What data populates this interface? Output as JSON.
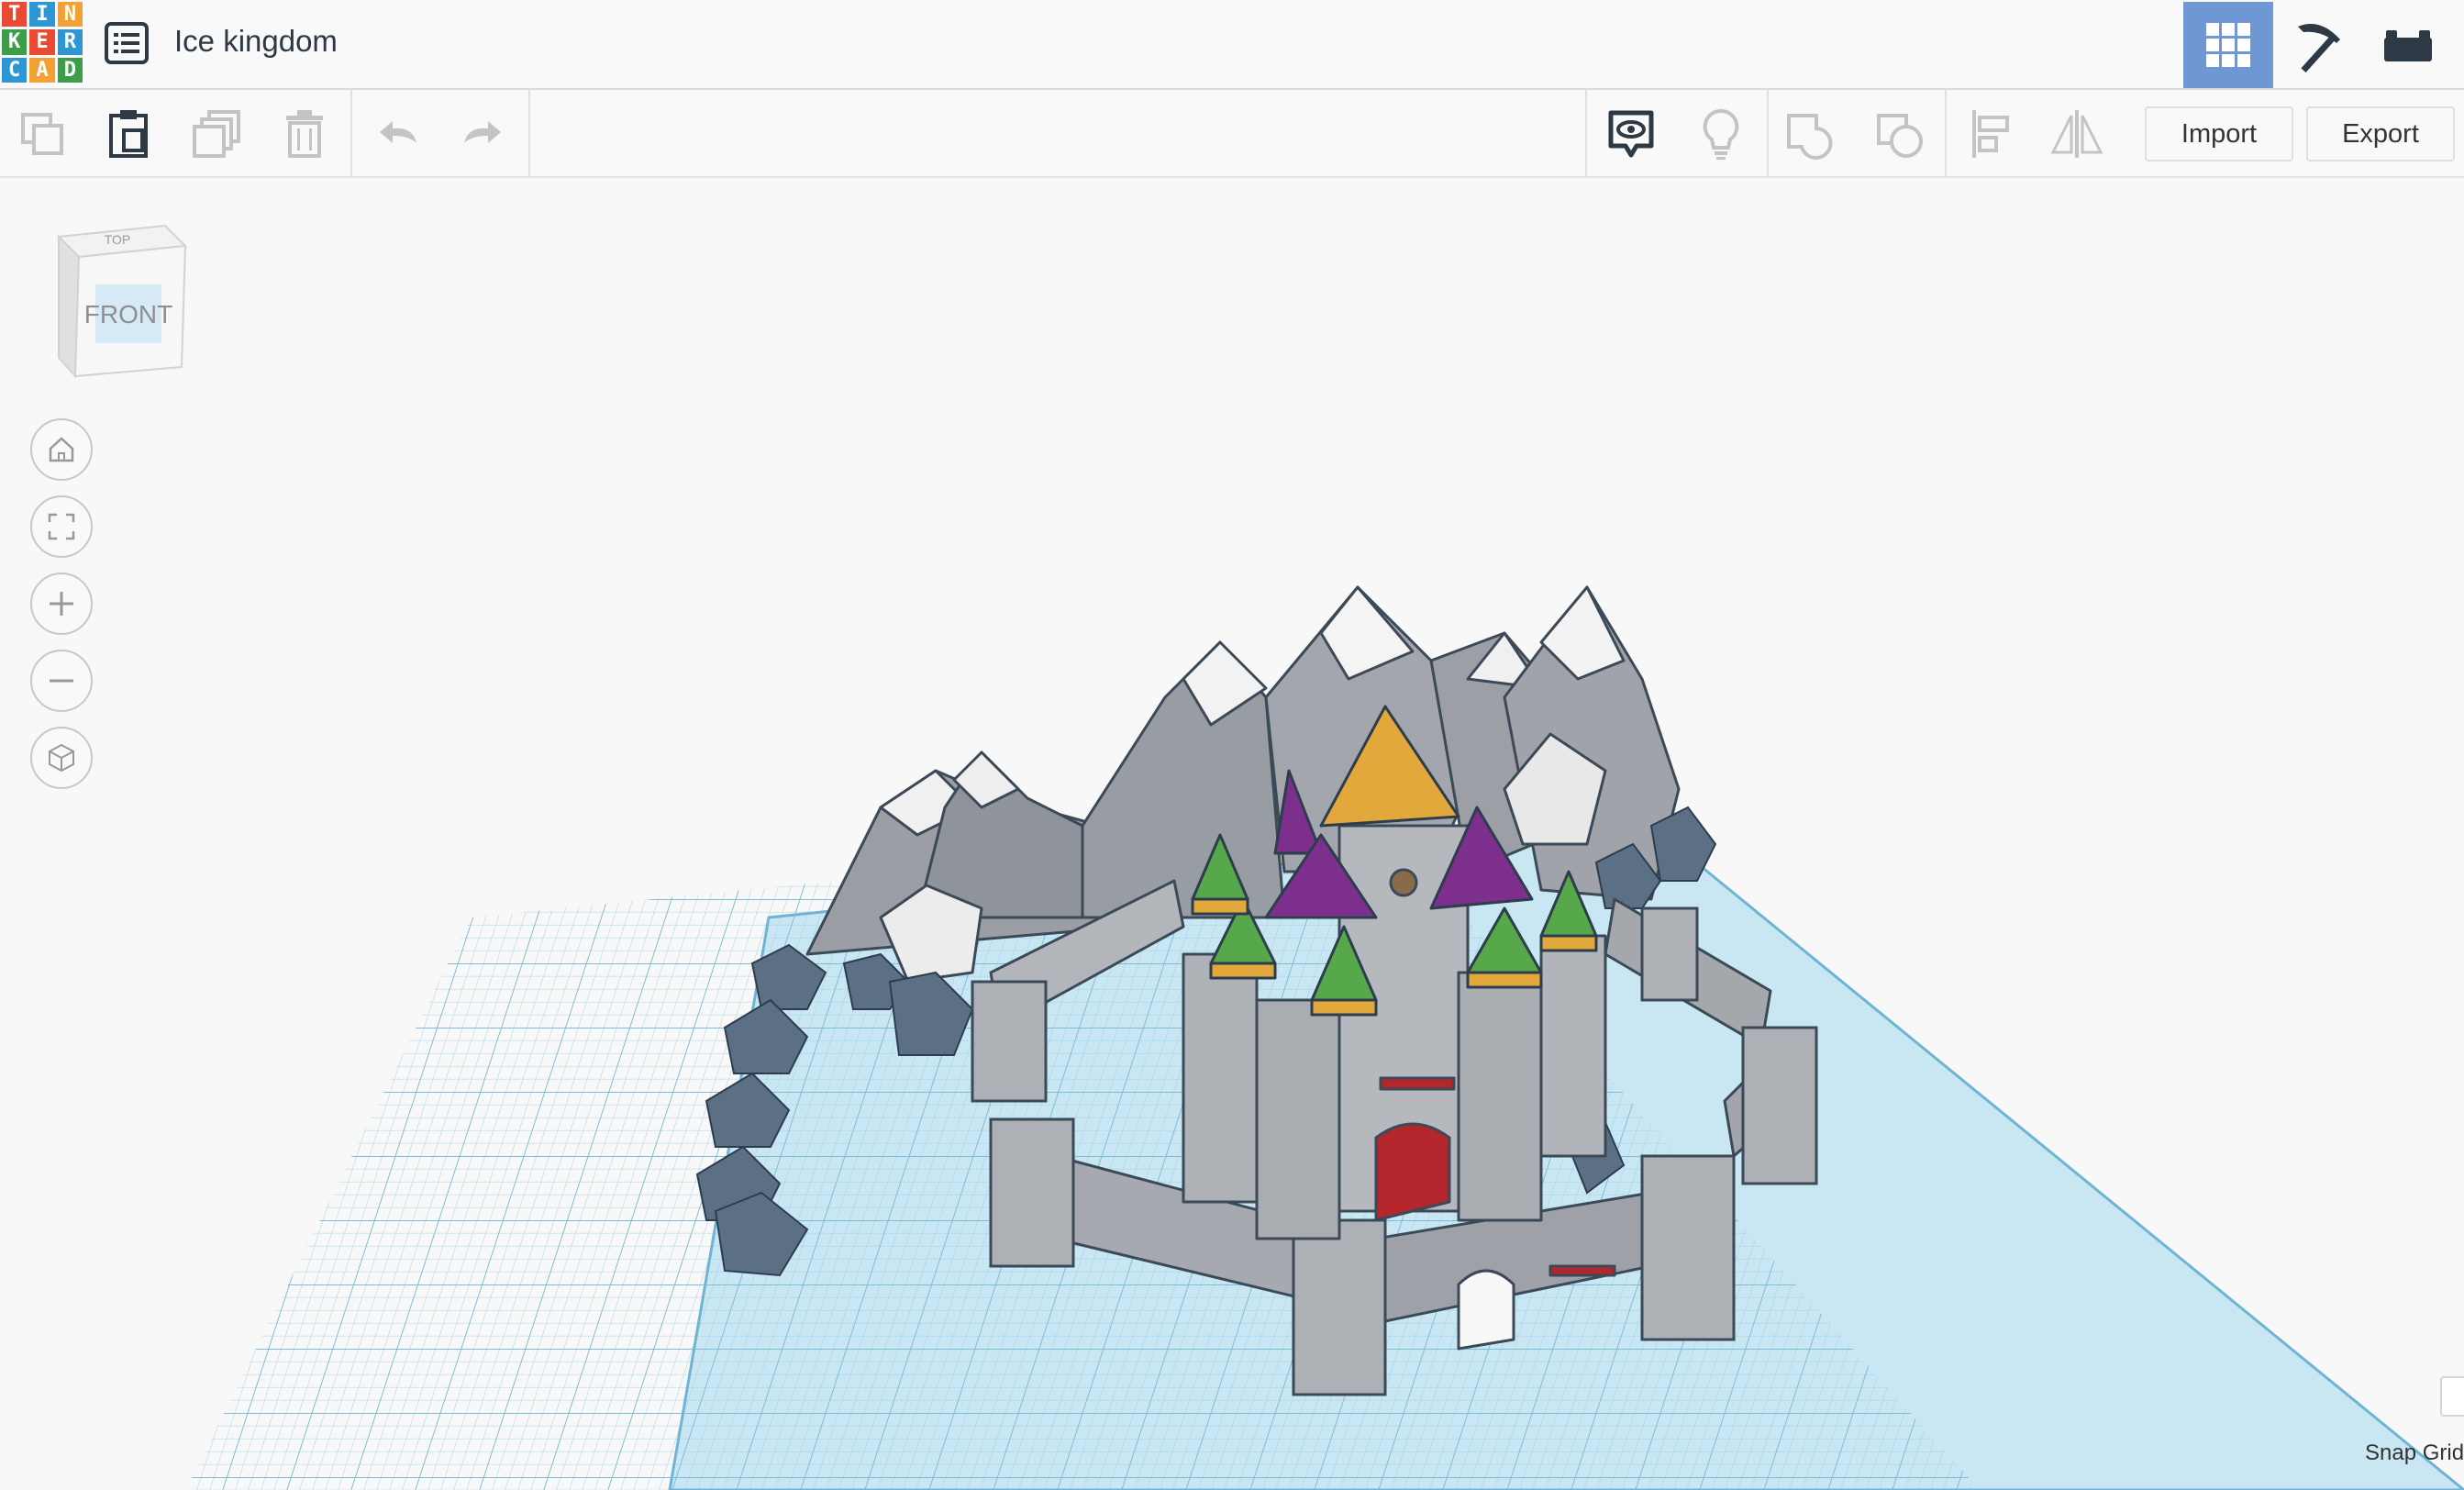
{
  "app": {
    "logo_letters": [
      "T",
      "I",
      "N",
      "K",
      "E",
      "R",
      "C",
      "A",
      "D"
    ],
    "logo_colors": [
      "#e94a34",
      "#2d96d3",
      "#f2a132",
      "#3d9e4a",
      "#e94a34",
      "#2d96d3",
      "#2d96d3",
      "#f2a132",
      "#3d9e4a"
    ],
    "menu_icon": "list-icon",
    "document_title": "Ice kingdom"
  },
  "views": [
    {
      "name": "3d-design-view",
      "icon": "grid-icon",
      "active": true
    },
    {
      "name": "blocks-view",
      "icon": "pickaxe-icon",
      "active": false
    },
    {
      "name": "bricks-view",
      "icon": "brick-icon",
      "active": false
    }
  ],
  "toolbar": {
    "left_icons": [
      "copy-icon",
      "paste-icon",
      "duplicate-icon",
      "delete-icon",
      "undo-icon",
      "redo-icon"
    ],
    "right_icons": [
      "show-all-icon",
      "light-bulb-icon",
      "group-icon",
      "ungroup-icon",
      "align-icon",
      "mirror-icon"
    ],
    "import_label": "Import",
    "export_label": "Export"
  },
  "view_cube": {
    "top_label": "TOP",
    "front_label": "FRONT"
  },
  "navigation": [
    "home-view-icon",
    "fit-all-icon",
    "zoom-in-icon",
    "zoom-out-icon",
    "perspective-icon"
  ],
  "workplane": {
    "snap_grid_label": "Snap Grid",
    "colors": {
      "plane": "#bfe0f0",
      "grid": "#8ec6e0",
      "stone": "#a8acb1",
      "gold": "#e3a83b",
      "purple": "#7d2f8e",
      "green": "#57a84a",
      "red": "#b3262b"
    }
  }
}
